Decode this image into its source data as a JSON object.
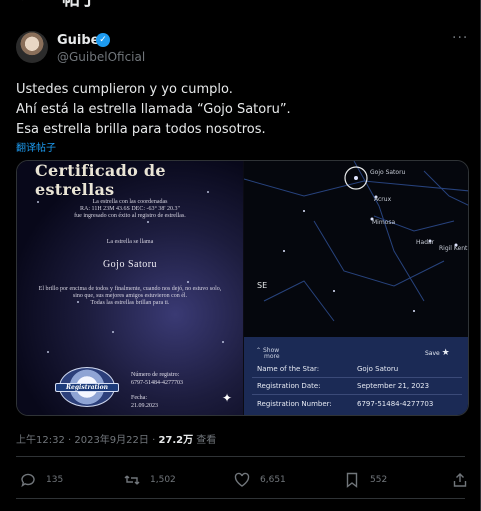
{
  "header": {
    "title": "帖子",
    "back_icon": "arrow-left-icon"
  },
  "author": {
    "name": "Guibel",
    "handle": "@GuibelOficial",
    "verified_color": "#1d9bf0"
  },
  "tweet": {
    "lines": [
      "Ustedes cumplieron y yo cumplo.",
      "Ahí está la estrella llamada “Gojo Satoru”.",
      "Esa estrella brilla para todos nosotros."
    ],
    "translate": "翻译帖子"
  },
  "certificate": {
    "title": "Certificado de estrellas",
    "intro": [
      "La estrella con las coordenadas",
      "RA: 11H 23M 43.6S   DEC: -63° 38' 20.3\"",
      "fue ingresado con éxito al registro de estrellas."
    ],
    "called": "La estrella se llama",
    "star_name": "Gojo Satoru",
    "quote": [
      "El brillo por encima de todos y finalmente, cuando nos dejó, no estuvo solo,",
      "sino que, sus mejores amigos estuvieron con él.",
      "Todas las estrellas brillan para ti."
    ],
    "seal_text": "Registration",
    "reg_number_label": "Número de registro:",
    "reg_number": "6797-51484-4277703",
    "date_label": "Fecha:",
    "date": "21.09.2023"
  },
  "skymap": {
    "labels": {
      "gojo": "Gojo Satoru",
      "acrux": "Acrux",
      "mimosa": "Mimosa",
      "hadar": "Hadar",
      "rigil": "Rigil Kent",
      "se": "SE"
    },
    "show_more": [
      "Show",
      "more"
    ],
    "save": "Save",
    "rows": [
      {
        "label": "Name of the Star:",
        "value": "Gojo Satoru"
      },
      {
        "label": "Registration Date:",
        "value": "September 21, 2023"
      },
      {
        "label": "Registration Number:",
        "value": "6797-51484-4277703"
      }
    ]
  },
  "meta": {
    "time": "上午12:32 · 2023年9月22日 · ",
    "views": "27.2万",
    "views_label": " 查看"
  },
  "actions": {
    "replies": "135",
    "retweets": "1,502",
    "likes": "6,651",
    "bookmarks": "552"
  },
  "colors": {
    "accent": "#1d9bf0",
    "muted": "#71767b",
    "panel": "#1b2a55"
  }
}
